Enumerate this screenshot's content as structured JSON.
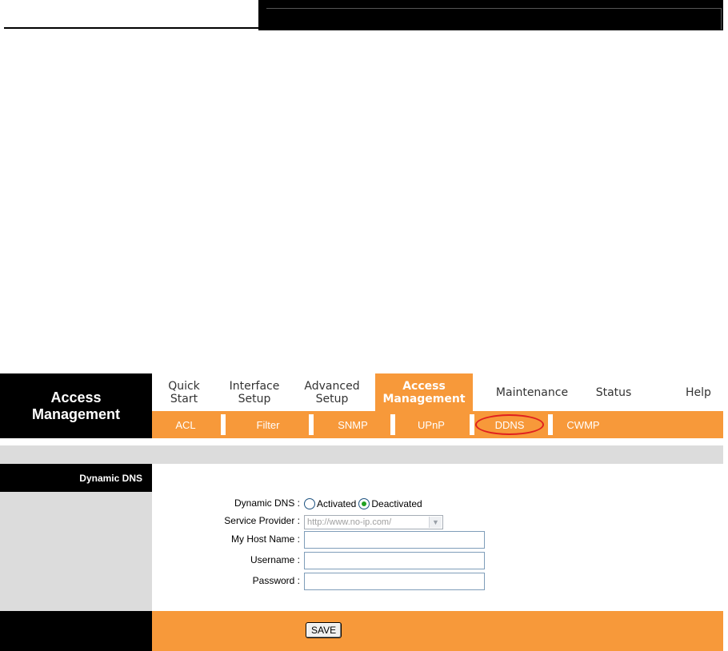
{
  "brand": {
    "title": "Access\nManagement"
  },
  "main_nav": [
    {
      "label": "Quick\nStart"
    },
    {
      "label": "Interface\nSetup"
    },
    {
      "label": "Advanced\nSetup"
    },
    {
      "label": "Access\nManagement",
      "active": true
    },
    {
      "label": "Maintenance"
    },
    {
      "label": "Status"
    },
    {
      "label": "Help"
    }
  ],
  "sub_nav": [
    {
      "label": "ACL"
    },
    {
      "label": "Filter"
    },
    {
      "label": "SNMP"
    },
    {
      "label": "UPnP"
    },
    {
      "label": "DDNS",
      "highlighted": true
    },
    {
      "label": "CWMP"
    }
  ],
  "section": {
    "title": "Dynamic DNS"
  },
  "form": {
    "dynamic_dns": {
      "label": "Dynamic DNS :",
      "options": [
        "Activated",
        "Deactivated"
      ],
      "selected": "Deactivated"
    },
    "service_provider": {
      "label": "Service Provider :",
      "value": "http://www.no-ip.com/"
    },
    "host_name": {
      "label": "My Host Name :",
      "value": ""
    },
    "username": {
      "label": "Username :",
      "value": ""
    },
    "password": {
      "label": "Password :",
      "value": ""
    }
  },
  "actions": {
    "save_label": "SAVE"
  },
  "colors": {
    "accent": "#f7993a",
    "dark": "#000000",
    "panel_gray": "#dcdcdc",
    "highlight_ring": "#e02020"
  }
}
